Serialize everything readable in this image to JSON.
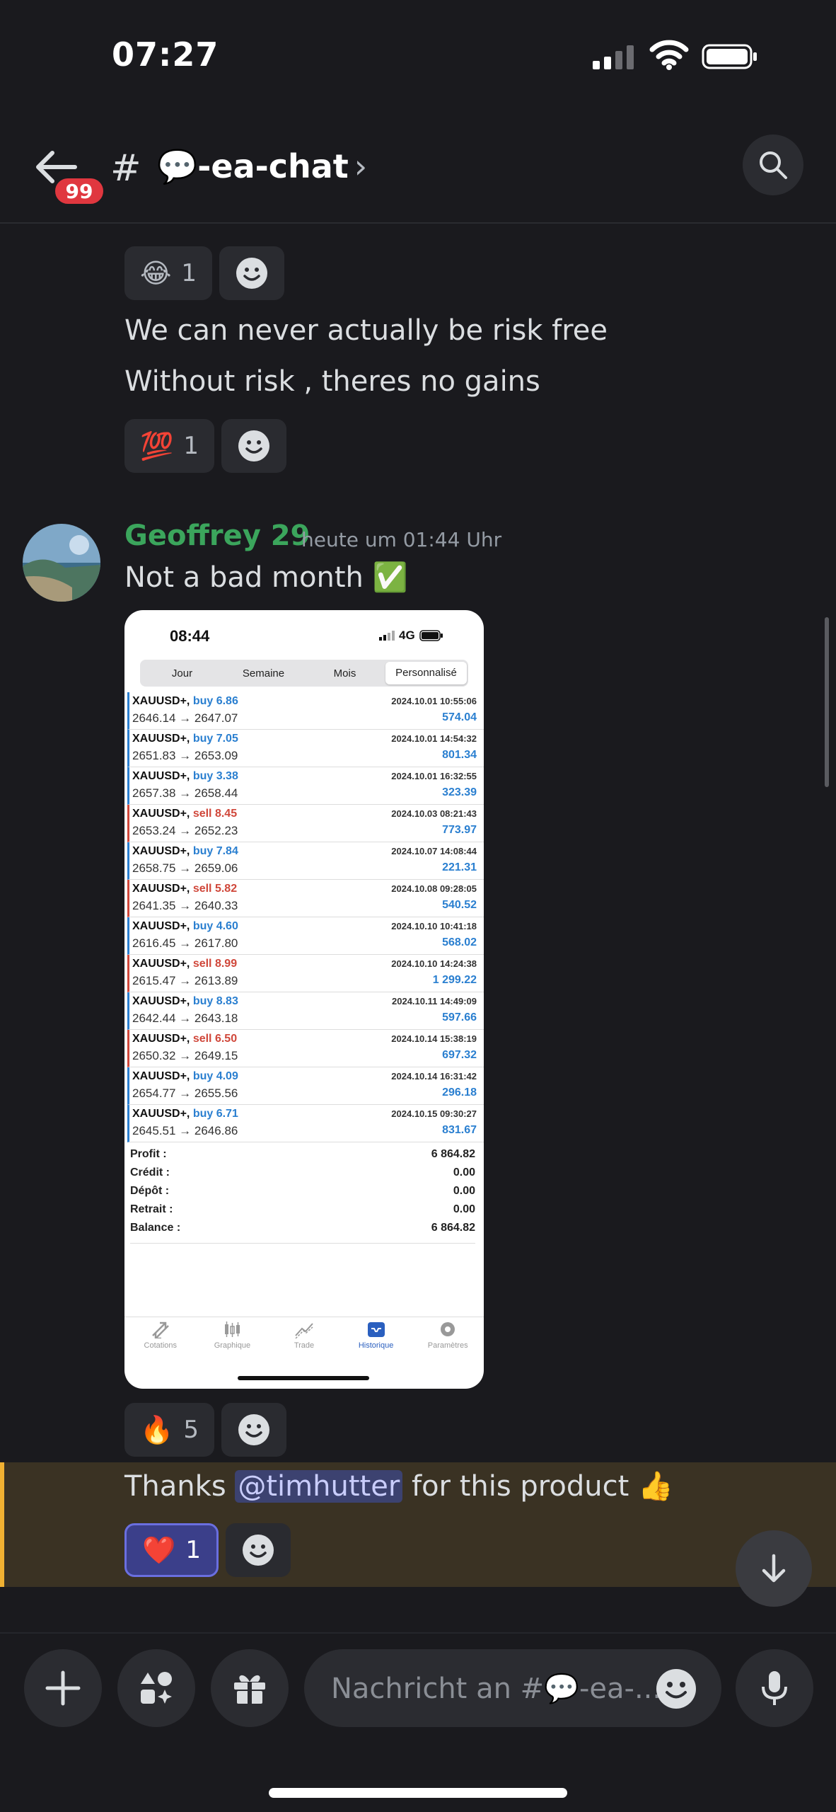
{
  "status_bar": {
    "time": "07:27"
  },
  "header": {
    "unread_count": "99",
    "hash": "#",
    "channel_name": "💬-ea-chat",
    "chevron": "›"
  },
  "messages": {
    "reaction1": {
      "emoji": "😂",
      "count": "1"
    },
    "line1": "We can never actually be risk free",
    "line2": "Without risk , theres no gains",
    "reaction2": {
      "emoji": "💯",
      "count": "1"
    },
    "geoffrey": {
      "username": "Geoffrey 29",
      "timestamp": "heute um 01:44 Uhr",
      "text": "Not a bad month ✅"
    },
    "reaction3": {
      "emoji": "🔥",
      "count": "5"
    },
    "thanks": {
      "before": "Thanks ",
      "mention": "@timhutter",
      "after": " for this product 👍"
    },
    "reaction4": {
      "emoji": "❤️",
      "count": "1"
    }
  },
  "attachment": {
    "time": "08:44",
    "network": "4G",
    "tabs": [
      "Jour",
      "Semaine",
      "Mois",
      "Personnalisé"
    ],
    "selected_tab": "Personnalisé",
    "trades": [
      {
        "symbol": "XAUUSD+,",
        "dir": "buy 6.86",
        "type": "buy",
        "prices": "2646.14 → 2647.07",
        "date": "2024.10.01 10:55:06",
        "profit": "574.04"
      },
      {
        "symbol": "XAUUSD+,",
        "dir": "buy 7.05",
        "type": "buy",
        "prices": "2651.83 → 2653.09",
        "date": "2024.10.01 14:54:32",
        "profit": "801.34"
      },
      {
        "symbol": "XAUUSD+,",
        "dir": "buy 3.38",
        "type": "buy",
        "prices": "2657.38 → 2658.44",
        "date": "2024.10.01 16:32:55",
        "profit": "323.39"
      },
      {
        "symbol": "XAUUSD+,",
        "dir": "sell 8.45",
        "type": "sell",
        "prices": "2653.24 → 2652.23",
        "date": "2024.10.03 08:21:43",
        "profit": "773.97"
      },
      {
        "symbol": "XAUUSD+,",
        "dir": "buy 7.84",
        "type": "buy",
        "prices": "2658.75 → 2659.06",
        "date": "2024.10.07 14:08:44",
        "profit": "221.31"
      },
      {
        "symbol": "XAUUSD+,",
        "dir": "sell 5.82",
        "type": "sell",
        "prices": "2641.35 → 2640.33",
        "date": "2024.10.08 09:28:05",
        "profit": "540.52"
      },
      {
        "symbol": "XAUUSD+,",
        "dir": "buy 4.60",
        "type": "buy",
        "prices": "2616.45 → 2617.80",
        "date": "2024.10.10 10:41:18",
        "profit": "568.02"
      },
      {
        "symbol": "XAUUSD+,",
        "dir": "sell 8.99",
        "type": "sell",
        "prices": "2615.47 → 2613.89",
        "date": "2024.10.10 14:24:38",
        "profit": "1 299.22"
      },
      {
        "symbol": "XAUUSD+,",
        "dir": "buy 8.83",
        "type": "buy",
        "prices": "2642.44 → 2643.18",
        "date": "2024.10.11 14:49:09",
        "profit": "597.66"
      },
      {
        "symbol": "XAUUSD+,",
        "dir": "sell 6.50",
        "type": "sell",
        "prices": "2650.32 → 2649.15",
        "date": "2024.10.14 15:38:19",
        "profit": "697.32"
      },
      {
        "symbol": "XAUUSD+,",
        "dir": "buy 4.09",
        "type": "buy",
        "prices": "2654.77 → 2655.56",
        "date": "2024.10.14 16:31:42",
        "profit": "296.18"
      },
      {
        "symbol": "XAUUSD+,",
        "dir": "buy 6.71",
        "type": "buy",
        "prices": "2645.51 → 2646.86",
        "date": "2024.10.15 09:30:27",
        "profit": "831.67"
      }
    ],
    "totals": [
      {
        "label": "Profit :",
        "value": "6 864.82"
      },
      {
        "label": "Crédit :",
        "value": "0.00"
      },
      {
        "label": "Dépôt :",
        "value": "0.00"
      },
      {
        "label": "Retrait :",
        "value": "0.00"
      },
      {
        "label": "Balance :",
        "value": "6 864.82"
      }
    ],
    "nav": [
      "Cotations",
      "Graphique",
      "Trade",
      "Historique",
      "Paramètres"
    ],
    "nav_selected": "Historique"
  },
  "composer": {
    "placeholder": "Nachricht an #💬-ea-..."
  },
  "colors": {
    "background": "#1a1a1e",
    "username_green": "#3ba55c",
    "mention_highlight": "#f0b132",
    "buy_blue": "#2a7fd0",
    "sell_red": "#d0473a"
  }
}
